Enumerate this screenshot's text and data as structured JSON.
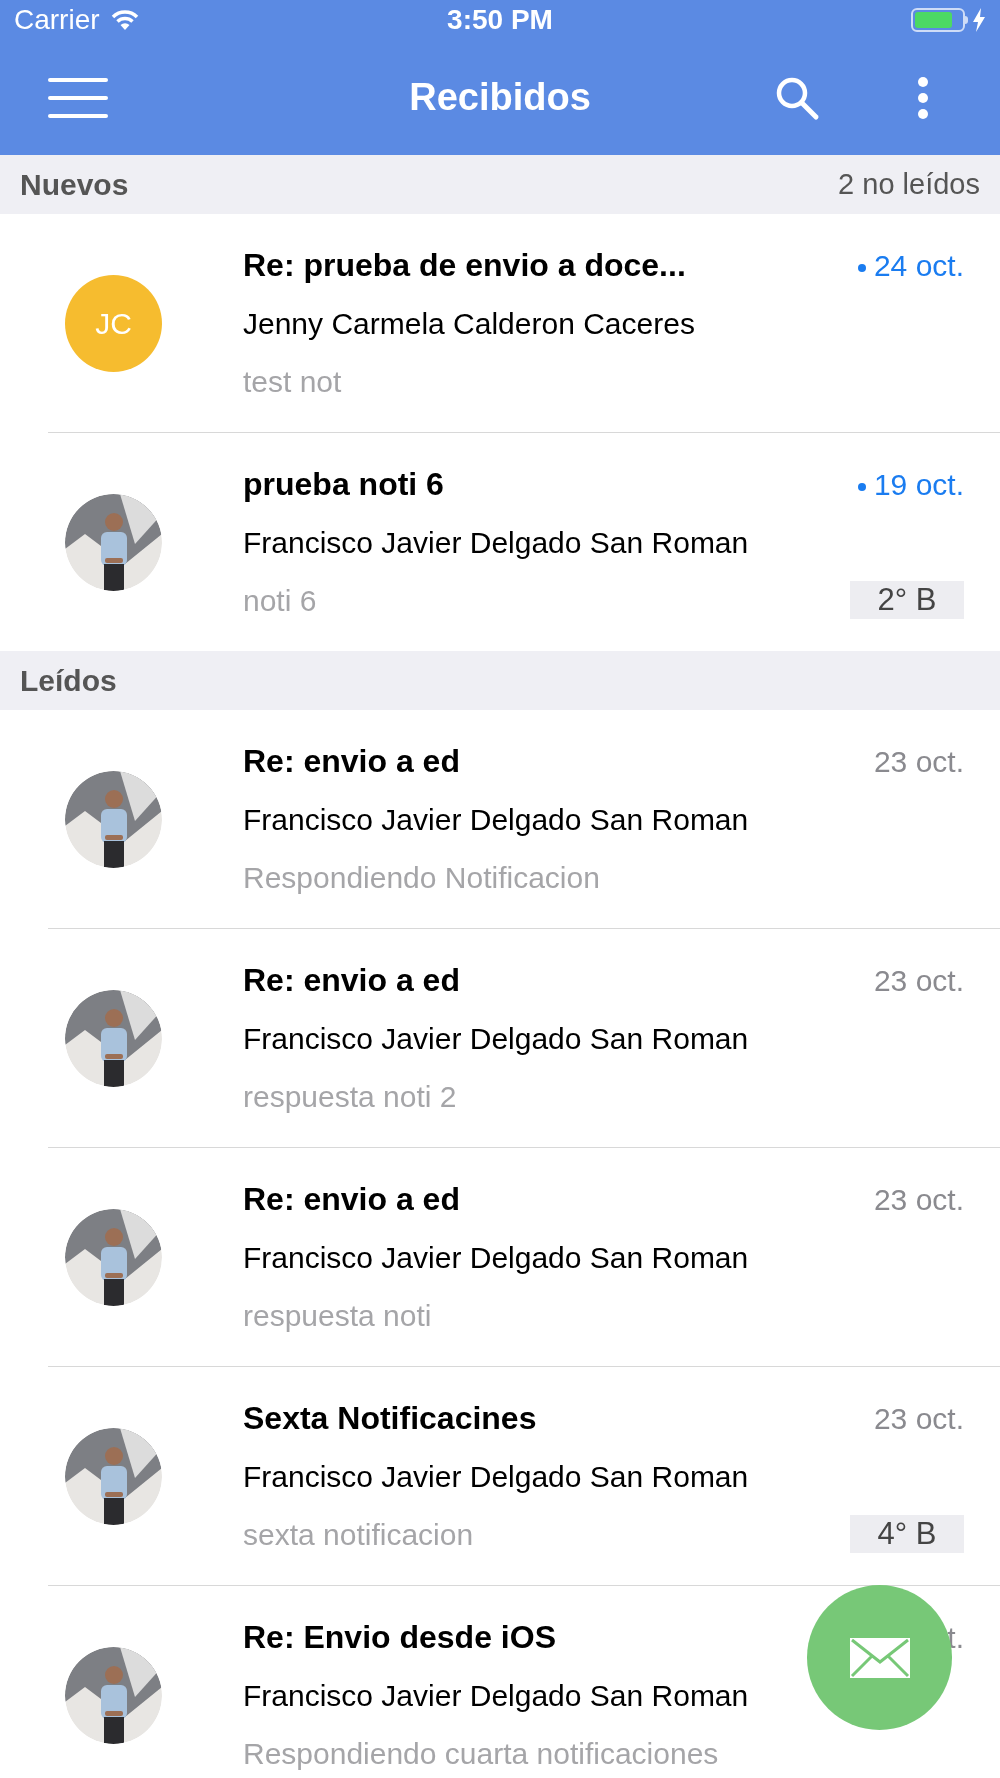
{
  "status_bar": {
    "carrier": "Carrier",
    "time": "3:50 PM"
  },
  "nav_bar": {
    "title": "Recibidos"
  },
  "sections": [
    {
      "title": "Nuevos",
      "count": "2 no leídos",
      "messages": [
        {
          "avatar": {
            "kind": "initials",
            "initials": "JC",
            "color": "#f6bc2f"
          },
          "subject": "Re: prueba de envio a doce...",
          "sender": "Jenny Carmela Calderon Caceres",
          "preview": "test not",
          "date": "24 oct.",
          "unread": true
        },
        {
          "subject": "prueba noti 6",
          "sender": "Francisco Javier Delgado San Roman",
          "preview": "noti 6",
          "date": "19 oct.",
          "unread": true,
          "tag": "2° B"
        }
      ]
    },
    {
      "title": "Leídos",
      "messages": [
        {
          "subject": "Re: envio a ed",
          "sender": "Francisco Javier Delgado San Roman",
          "preview": "Respondiendo Notificacion",
          "date": "23 oct.",
          "unread": false
        },
        {
          "subject": "Re: envio a ed",
          "sender": "Francisco Javier Delgado San Roman",
          "preview": "respuesta noti 2",
          "date": "23 oct.",
          "unread": false
        },
        {
          "subject": "Re: envio a ed",
          "sender": "Francisco Javier Delgado San Roman",
          "preview": "respuesta noti",
          "date": "23 oct.",
          "unread": false
        },
        {
          "subject": "Sexta Notificacines",
          "sender": "Francisco Javier Delgado San Roman",
          "preview": "sexta notificacion",
          "date": "23 oct.",
          "unread": false,
          "tag": "4° B"
        },
        {
          "subject": "Re: Envio desde iOS",
          "sender": "Francisco Javier Delgado San Roman",
          "preview": "Respondiendo cuarta notificaciones",
          "date": "t.",
          "unread": false
        }
      ]
    }
  ]
}
